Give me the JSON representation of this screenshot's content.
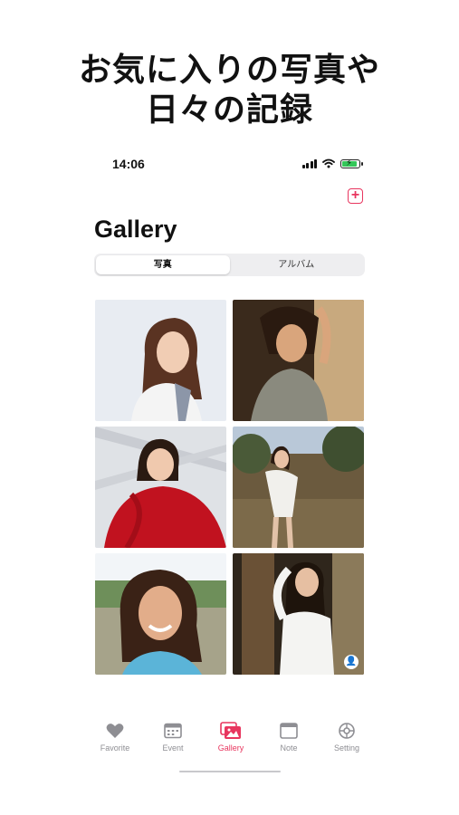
{
  "headline": {
    "line1": "お気に入りの写真や",
    "line2": "日々の記録"
  },
  "status_bar": {
    "time": "14:06"
  },
  "header": {
    "title": "Gallery",
    "add_icon": "plus-square-icon"
  },
  "segmented": {
    "tabs": [
      "写真",
      "アルバム"
    ],
    "selected": "写真"
  },
  "gallery": {
    "photos": [
      {
        "description": "woman-portrait-1"
      },
      {
        "description": "woman-portrait-2"
      },
      {
        "description": "woman-red-dress"
      },
      {
        "description": "woman-white-outfit"
      },
      {
        "description": "woman-smiling-park"
      },
      {
        "description": "woman-by-tree",
        "badge_icon": "person-badge-icon"
      }
    ]
  },
  "tab_bar": {
    "items": [
      {
        "label": "Favorite",
        "icon": "heart-icon"
      },
      {
        "label": "Event",
        "icon": "calendar-icon"
      },
      {
        "label": "Gallery",
        "icon": "photos-icon"
      },
      {
        "label": "Note",
        "icon": "note-icon"
      },
      {
        "label": "Setting",
        "icon": "gear-icon"
      }
    ],
    "active": "Gallery"
  },
  "colors": {
    "accent": "#e8365f",
    "inactive": "#8e8e93",
    "battery": "#34c759"
  }
}
